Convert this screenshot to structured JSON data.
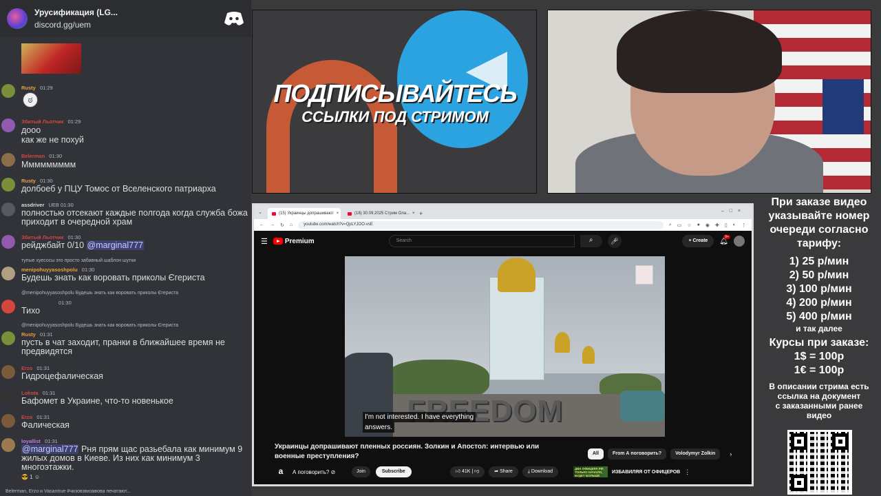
{
  "chat": {
    "server_name": "Урусификация (LG...",
    "server_link": "discord.gg/uem",
    "messages": [
      {
        "user": "Rusty",
        "user_color": "#e8a33d",
        "time": "01:29",
        "text": "",
        "avatar": "#7a8f3a"
      },
      {
        "user": "Збитый Льотчик",
        "user_color": "#d4473f",
        "time": "01:29",
        "text_lines": [
          "дооо",
          "как же не похуй"
        ],
        "avatar": "#8f5ab0"
      },
      {
        "user": "Belerman",
        "user_color": "#d4473f",
        "time": "01:30",
        "text": "Ммммммммм",
        "avatar": "#8a6e4b"
      },
      {
        "user": "Rusty",
        "user_color": "#e8a33d",
        "time": "01:30",
        "text": "долбоеб у ПЦУ Томос от Вселенского патриарха",
        "avatar": "#7a8f3a"
      },
      {
        "user": "assdriver",
        "user_color": "#dbdee1",
        "badge": "UEB",
        "time": "01:30",
        "text": "полностью отсекают каждые полгода когда служба божа приходит в очередной храм",
        "avatar": "#555a60"
      },
      {
        "user": "Збитый Льотчик",
        "user_color": "#d4473f",
        "time": "01:30",
        "text": "рейджбайт 0/10",
        "mention": "@marginal777",
        "avatar": "#8f5ab0"
      },
      {
        "reply": "тупые хуесосы это просто забавный шаблон шутки",
        "user": "menipohuyyasoshpolu",
        "user_color": "#e8a33d",
        "time": "01:30",
        "text": "Будешь знать как воровать приколы Єгериста",
        "avatar": "#b0a080"
      },
      {
        "reply": "@menipohuyyasoshpolu Будешь знать как воровать приколы Єгериста",
        "time": "01:30",
        "text": "Тихо",
        "avatar": "#d4473f"
      },
      {
        "reply": "@menipohuyyasoshpolu Будешь знать как воровать приколы Єгериста",
        "user": "Rusty",
        "user_color": "#e8a33d",
        "time": "01:31",
        "text": "пусть в чат заходит, пранки в ближайшее время не предвидятся",
        "avatar": "#7a8f3a"
      },
      {
        "user": "Erzo",
        "user_color": "#d4473f",
        "time": "01:31",
        "text": "Гидроцефалическая",
        "avatar": "#7b5b3b"
      },
      {
        "user": "Lokota",
        "user_color": "#d4473f",
        "time": "01:31",
        "text": "Бафомет в Украине, что-то новенькое",
        "avatar": "#333"
      },
      {
        "user": "Erzo",
        "user_color": "#d4473f",
        "time": "01:31",
        "text": "Фалическая",
        "avatar": "#7b5b3b"
      },
      {
        "user": "loyallist",
        "user_color": "#c27ee6",
        "time": "01:31",
        "mention": "@marginal777",
        "text": "Рня прям щас разьебала как минимум 9 жилых домов в Киеве. Из них как минимум 3 многоэтажки.",
        "avatar": "#9c7a50"
      }
    ],
    "reaction_count": "1",
    "typing": "Belerman, Erzo и Vasantrue #чизовзвизавова печатают..."
  },
  "promo": {
    "title": "ПОДПИСЫВАЙТЕСЬ",
    "subtitle": "ССЫЛКИ ПОД СТРИМОМ"
  },
  "info": {
    "lines": [
      "При заказе видео",
      "указывайте номер",
      "очереди согласно",
      "тарифу:"
    ],
    "tariffs": [
      "1) 25 р/мин",
      "2) 50 р/мин",
      "3) 100 р/мин",
      "4) 200 р/мин",
      "5) 400 р/мин"
    ],
    "etc": "и так далее",
    "course_title": "Курсы при заказе:",
    "courses": [
      "1$ = 100р",
      "1€ = 100р"
    ],
    "desc_lines": [
      "В описании стрима есть",
      "ссылка на документ",
      "с заказанными ранее",
      "видео"
    ]
  },
  "browser": {
    "tabs": [
      "(15) Украинцы допрашивают",
      "(18) 30.09.2025 Стрим Ола..."
    ],
    "url": "youtube.com/watch?v=QpLYJOO-vsE",
    "yt": {
      "logo": "Premium",
      "search_placeholder": "Search",
      "create": "Create",
      "notifications": "9+",
      "caption_1": "I'm not interested. I have everything",
      "caption_2": "answers.",
      "freedom": "FREEDOM",
      "title": "Украинцы допрашивают пленных россиян. Золкин и Апостол: интервью или военные преступления?",
      "chips": [
        "All",
        "From А поговорить?",
        "Volodymyr Zolkin"
      ],
      "channel": "А поговорить? ⊘",
      "join": "Join",
      "subscribe": "Subscribe",
      "likes": "41K",
      "share": "Share",
      "download": "Download",
      "rec_thumb_text": "ДВА ОФИЦЕРА РФ. ТОЛЬКО НАЧАЛО, БУДЕТ БОЛЬШЕ",
      "rec_title": "ИЗБАВИЛЯЯ ОТ ОФИЦЕРОВ"
    }
  }
}
